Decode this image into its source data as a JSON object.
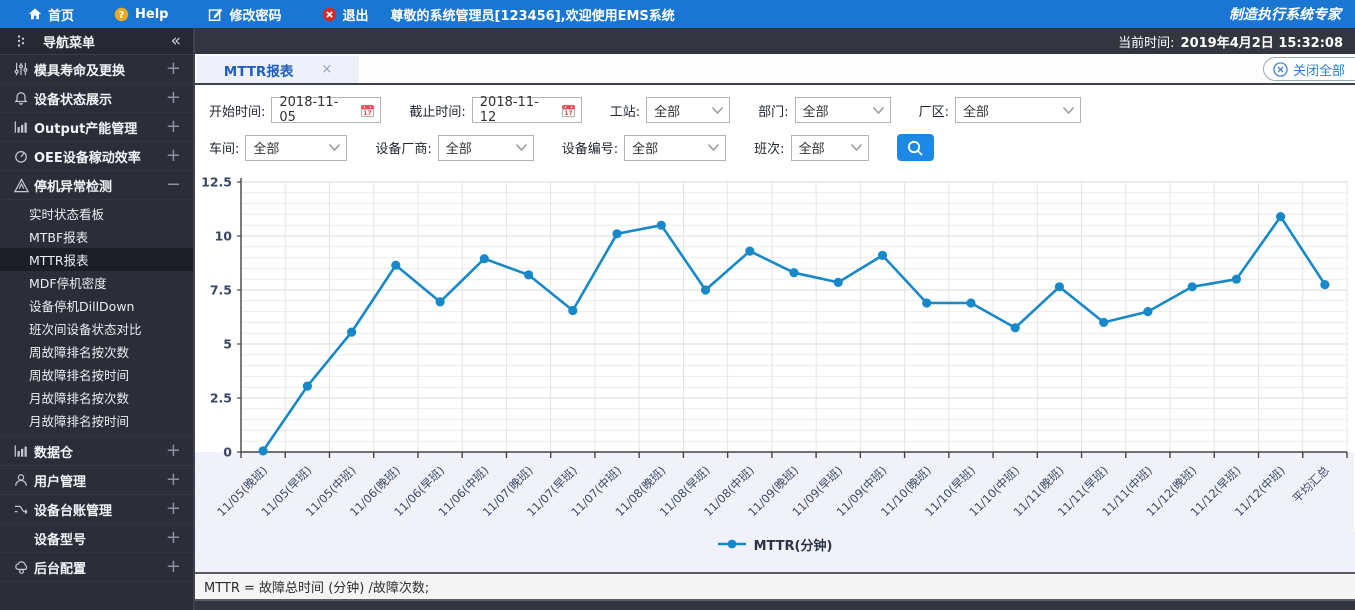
{
  "topbar": {
    "items": [
      {
        "name": "nav-home",
        "icon": "home-icon",
        "label": "首页"
      },
      {
        "name": "nav-help",
        "icon": "help-icon",
        "label": "Help"
      },
      {
        "name": "nav-change-password",
        "icon": "edit-icon",
        "label": "修改密码"
      },
      {
        "name": "nav-logout",
        "icon": "exit-icon",
        "label": "退出"
      }
    ],
    "welcome": "尊敬的系统管理员[123456],欢迎使用EMS系统",
    "brand": "制造执行系统专家"
  },
  "infobar": {
    "time_label": "当前时间:",
    "time_value": "2019年4月2日 15:32:08"
  },
  "sidebar": {
    "title": "导航菜单",
    "collapse_icon": "«",
    "groups": [
      {
        "name": "mold-life",
        "icon": "sliders-icon",
        "label": "模具寿命及更换",
        "state": "collapsed"
      },
      {
        "name": "device-status",
        "icon": "bell-icon",
        "label": "设备状态展示",
        "state": "collapsed"
      },
      {
        "name": "output-capacity",
        "icon": "barchart-icon",
        "label": "Output产能管理",
        "state": "collapsed"
      },
      {
        "name": "oee",
        "icon": "gauge-icon",
        "label": "OEE设备稼动效率",
        "state": "collapsed"
      },
      {
        "name": "downtime-detect",
        "icon": "warning-icon",
        "label": "停机异常检测",
        "state": "expanded",
        "children": [
          "实时状态看板",
          "MTBF报表",
          "MTTR报表",
          "MDF停机密度",
          "设备停机DillDown",
          "班次间设备状态对比",
          "周故障排名按次数",
          "周故障排名按时间",
          "月故障排名按次数",
          "月故障排名按时间"
        ],
        "active_child": "MTTR报表"
      },
      {
        "name": "data-warehouse",
        "icon": "barchart-icon",
        "label": "数据仓",
        "state": "collapsed"
      },
      {
        "name": "user-management",
        "icon": "user-icon",
        "label": "用户管理",
        "state": "collapsed"
      },
      {
        "name": "device-ledger",
        "icon": "shuffle-icon",
        "label": "设备台账管理",
        "state": "collapsed"
      },
      {
        "name": "device-model",
        "icon": "none",
        "label": "设备型号",
        "state": "collapsed"
      },
      {
        "name": "backend-config",
        "icon": "cloud-gear-icon",
        "label": "后台配置",
        "state": "collapsed"
      }
    ]
  },
  "tabs": {
    "active": "MTTR报表",
    "close_icon": "×",
    "close_all": "关闭全部",
    "close_all_icon": "circle-x-icon"
  },
  "filters": {
    "row1": [
      {
        "name": "start-date",
        "label": "开始时间:",
        "type": "date",
        "value": "2018-11-05",
        "icon": "calendar-icon"
      },
      {
        "name": "end-date",
        "label": "截止时间:",
        "type": "date",
        "value": "2018-11-12",
        "icon": "calendar-icon"
      },
      {
        "name": "station",
        "label": "工站:",
        "type": "select",
        "value": "全部",
        "icon": "chevron-down-icon"
      },
      {
        "name": "department",
        "label": "部门:",
        "type": "select",
        "value": "全部",
        "icon": "chevron-down-icon"
      },
      {
        "name": "plant",
        "label": "厂区:",
        "type": "select",
        "value": "全部",
        "icon": "chevron-down-icon"
      }
    ],
    "row2": [
      {
        "name": "workshop",
        "label": "车间:",
        "type": "select",
        "value": "全部",
        "icon": "chevron-down-icon"
      },
      {
        "name": "vendor",
        "label": "设备厂商:",
        "type": "select",
        "value": "全部",
        "icon": "chevron-down-icon"
      },
      {
        "name": "device-id",
        "label": "设备编号:",
        "type": "select",
        "value": "全部",
        "icon": "chevron-down-icon"
      },
      {
        "name": "shift",
        "label": "班次:",
        "type": "select",
        "value": "全部",
        "icon": "chevron-down-icon"
      }
    ],
    "search_icon": "magnifier-icon"
  },
  "chart_data": {
    "type": "line",
    "title": "",
    "xlabel": "",
    "ylabel": "",
    "legend": "MTTR(分钟)",
    "legend_position": "bottom",
    "grid": true,
    "line_color": "#1788c9",
    "ylim": [
      0,
      12.5
    ],
    "yticks": [
      0,
      2.5,
      5,
      7.5,
      10,
      12.5
    ],
    "minor_step": 0.5,
    "categories": [
      "11/05(晚班)",
      "11/05(早班)",
      "11/05(中班)",
      "11/06(晚班)",
      "11/06(早班)",
      "11/06(中班)",
      "11/07(晚班)",
      "11/07(早班)",
      "11/07(中班)",
      "11/08(晚班)",
      "11/08(早班)",
      "11/08(中班)",
      "11/09(晚班)",
      "11/09(早班)",
      "11/09(中班)",
      "11/10(晚班)",
      "11/10(早班)",
      "11/10(中班)",
      "11/11(晚班)",
      "11/11(早班)",
      "11/11(中班)",
      "11/12(晚班)",
      "11/12(早班)",
      "11/12(中班)",
      "平均汇总"
    ],
    "series": [
      {
        "name": "MTTR(分钟)",
        "values": [
          0.05,
          3.05,
          5.55,
          8.65,
          6.95,
          8.95,
          8.2,
          6.55,
          10.1,
          10.5,
          7.5,
          9.3,
          8.3,
          7.85,
          9.1,
          6.9,
          6.9,
          5.75,
          7.65,
          6.0,
          6.5,
          7.65,
          8.0,
          10.9,
          7.75
        ]
      }
    ]
  },
  "footer": {
    "formula": "MTTR = 故障总时间 (分钟) /故障次数;"
  }
}
